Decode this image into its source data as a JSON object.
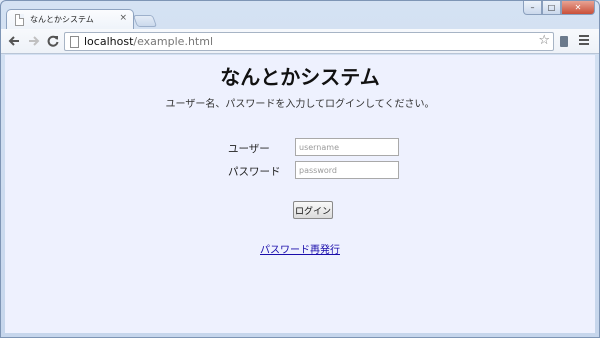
{
  "browser": {
    "tab_title": "なんとかシステム",
    "tab_close": "×",
    "url_host": "localhost",
    "url_path": "/example.html",
    "back_icon": "arrow-left-icon",
    "forward_icon": "arrow-right-icon",
    "reload_icon": "reload-icon",
    "star_icon": "star-icon",
    "menu_icon": "hamburger-icon"
  },
  "window_controls": {
    "minimize": "–",
    "maximize": "□",
    "close": "✕"
  },
  "page": {
    "title": "なんとかシステム",
    "subtitle": "ユーザー名、パスワードを入力してログインしてください。",
    "username_label": "ユーザー",
    "username_placeholder": "username",
    "password_label": "パスワード",
    "password_placeholder": "password",
    "login_button": "ログイン",
    "reset_link": "パスワード再発行"
  },
  "colors": {
    "page_background": "#eef1fe",
    "link": "#1a0dab"
  }
}
